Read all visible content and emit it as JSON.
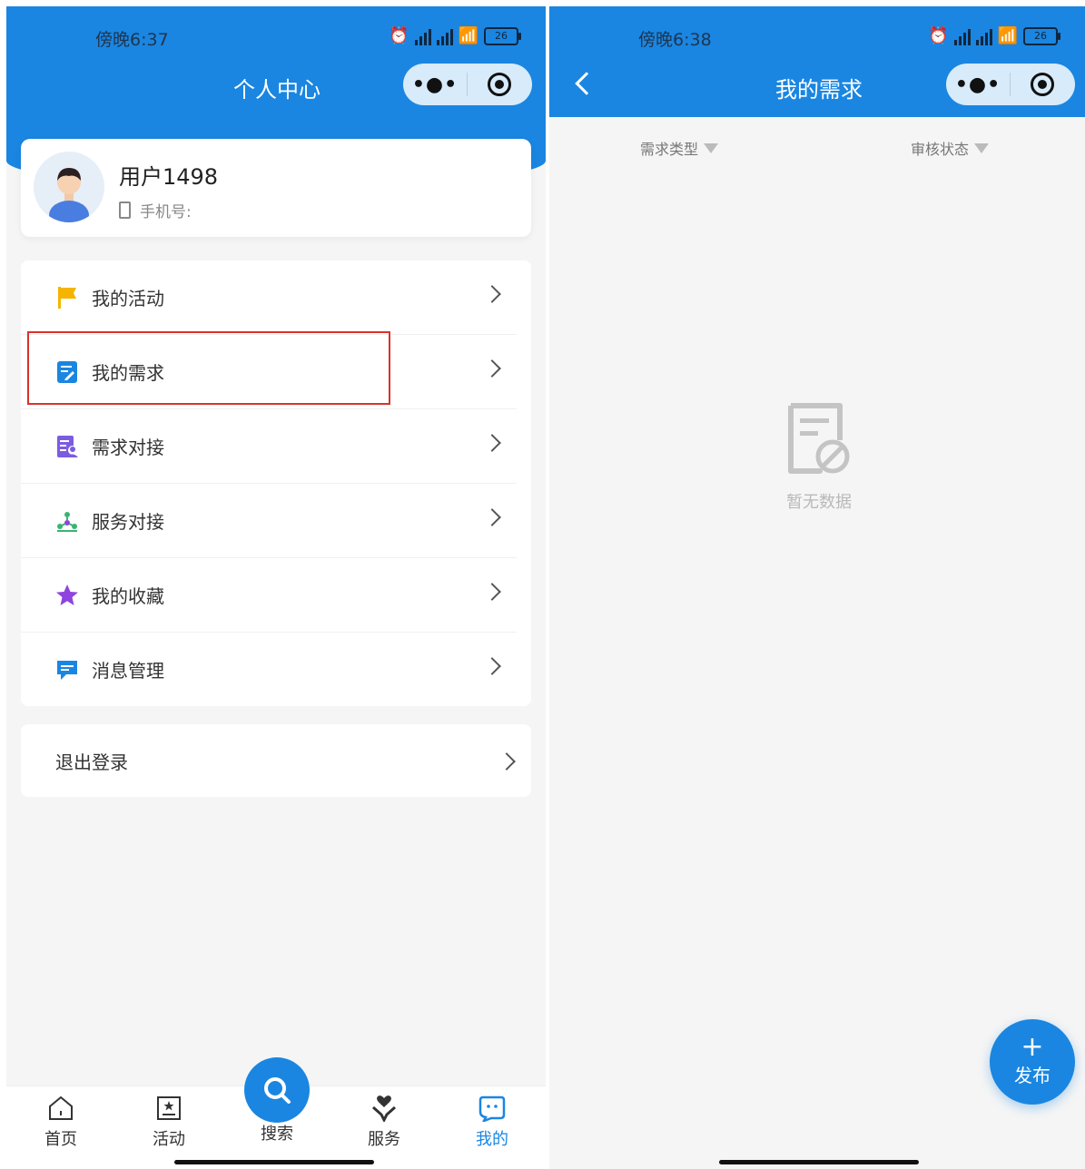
{
  "left": {
    "status_time": "傍晚6:37",
    "battery": "26",
    "nav_title": "个人中心",
    "user": {
      "name": "用户1498",
      "phone_label": "手机号:"
    },
    "menu": [
      {
        "label": "我的活动",
        "icon": "flag-icon",
        "color": "#f5b400"
      },
      {
        "label": "我的需求",
        "icon": "requirement-doc-icon",
        "color": "#1a86e1"
      },
      {
        "label": "需求对接",
        "icon": "docking-icon",
        "color": "#7b5ce0"
      },
      {
        "label": "服务对接",
        "icon": "service-network-icon",
        "color": "#3cb371"
      },
      {
        "label": "我的收藏",
        "icon": "star-icon",
        "color": "#8e44dd"
      },
      {
        "label": "消息管理",
        "icon": "message-icon",
        "color": "#1a86e1"
      }
    ],
    "logout": "退出登录",
    "tabs": {
      "home": "首页",
      "activity": "活动",
      "search": "搜索",
      "service": "服务",
      "mine": "我的"
    },
    "active_color": "#1a86e1",
    "highlight_color": "#d9322b"
  },
  "right": {
    "status_time": "傍晚6:38",
    "battery": "26",
    "nav_title": "我的需求",
    "filters": {
      "type": "需求类型",
      "status": "审核状态"
    },
    "empty_text": "暂无数据",
    "publish_plus": "+",
    "publish_label": "发布"
  }
}
